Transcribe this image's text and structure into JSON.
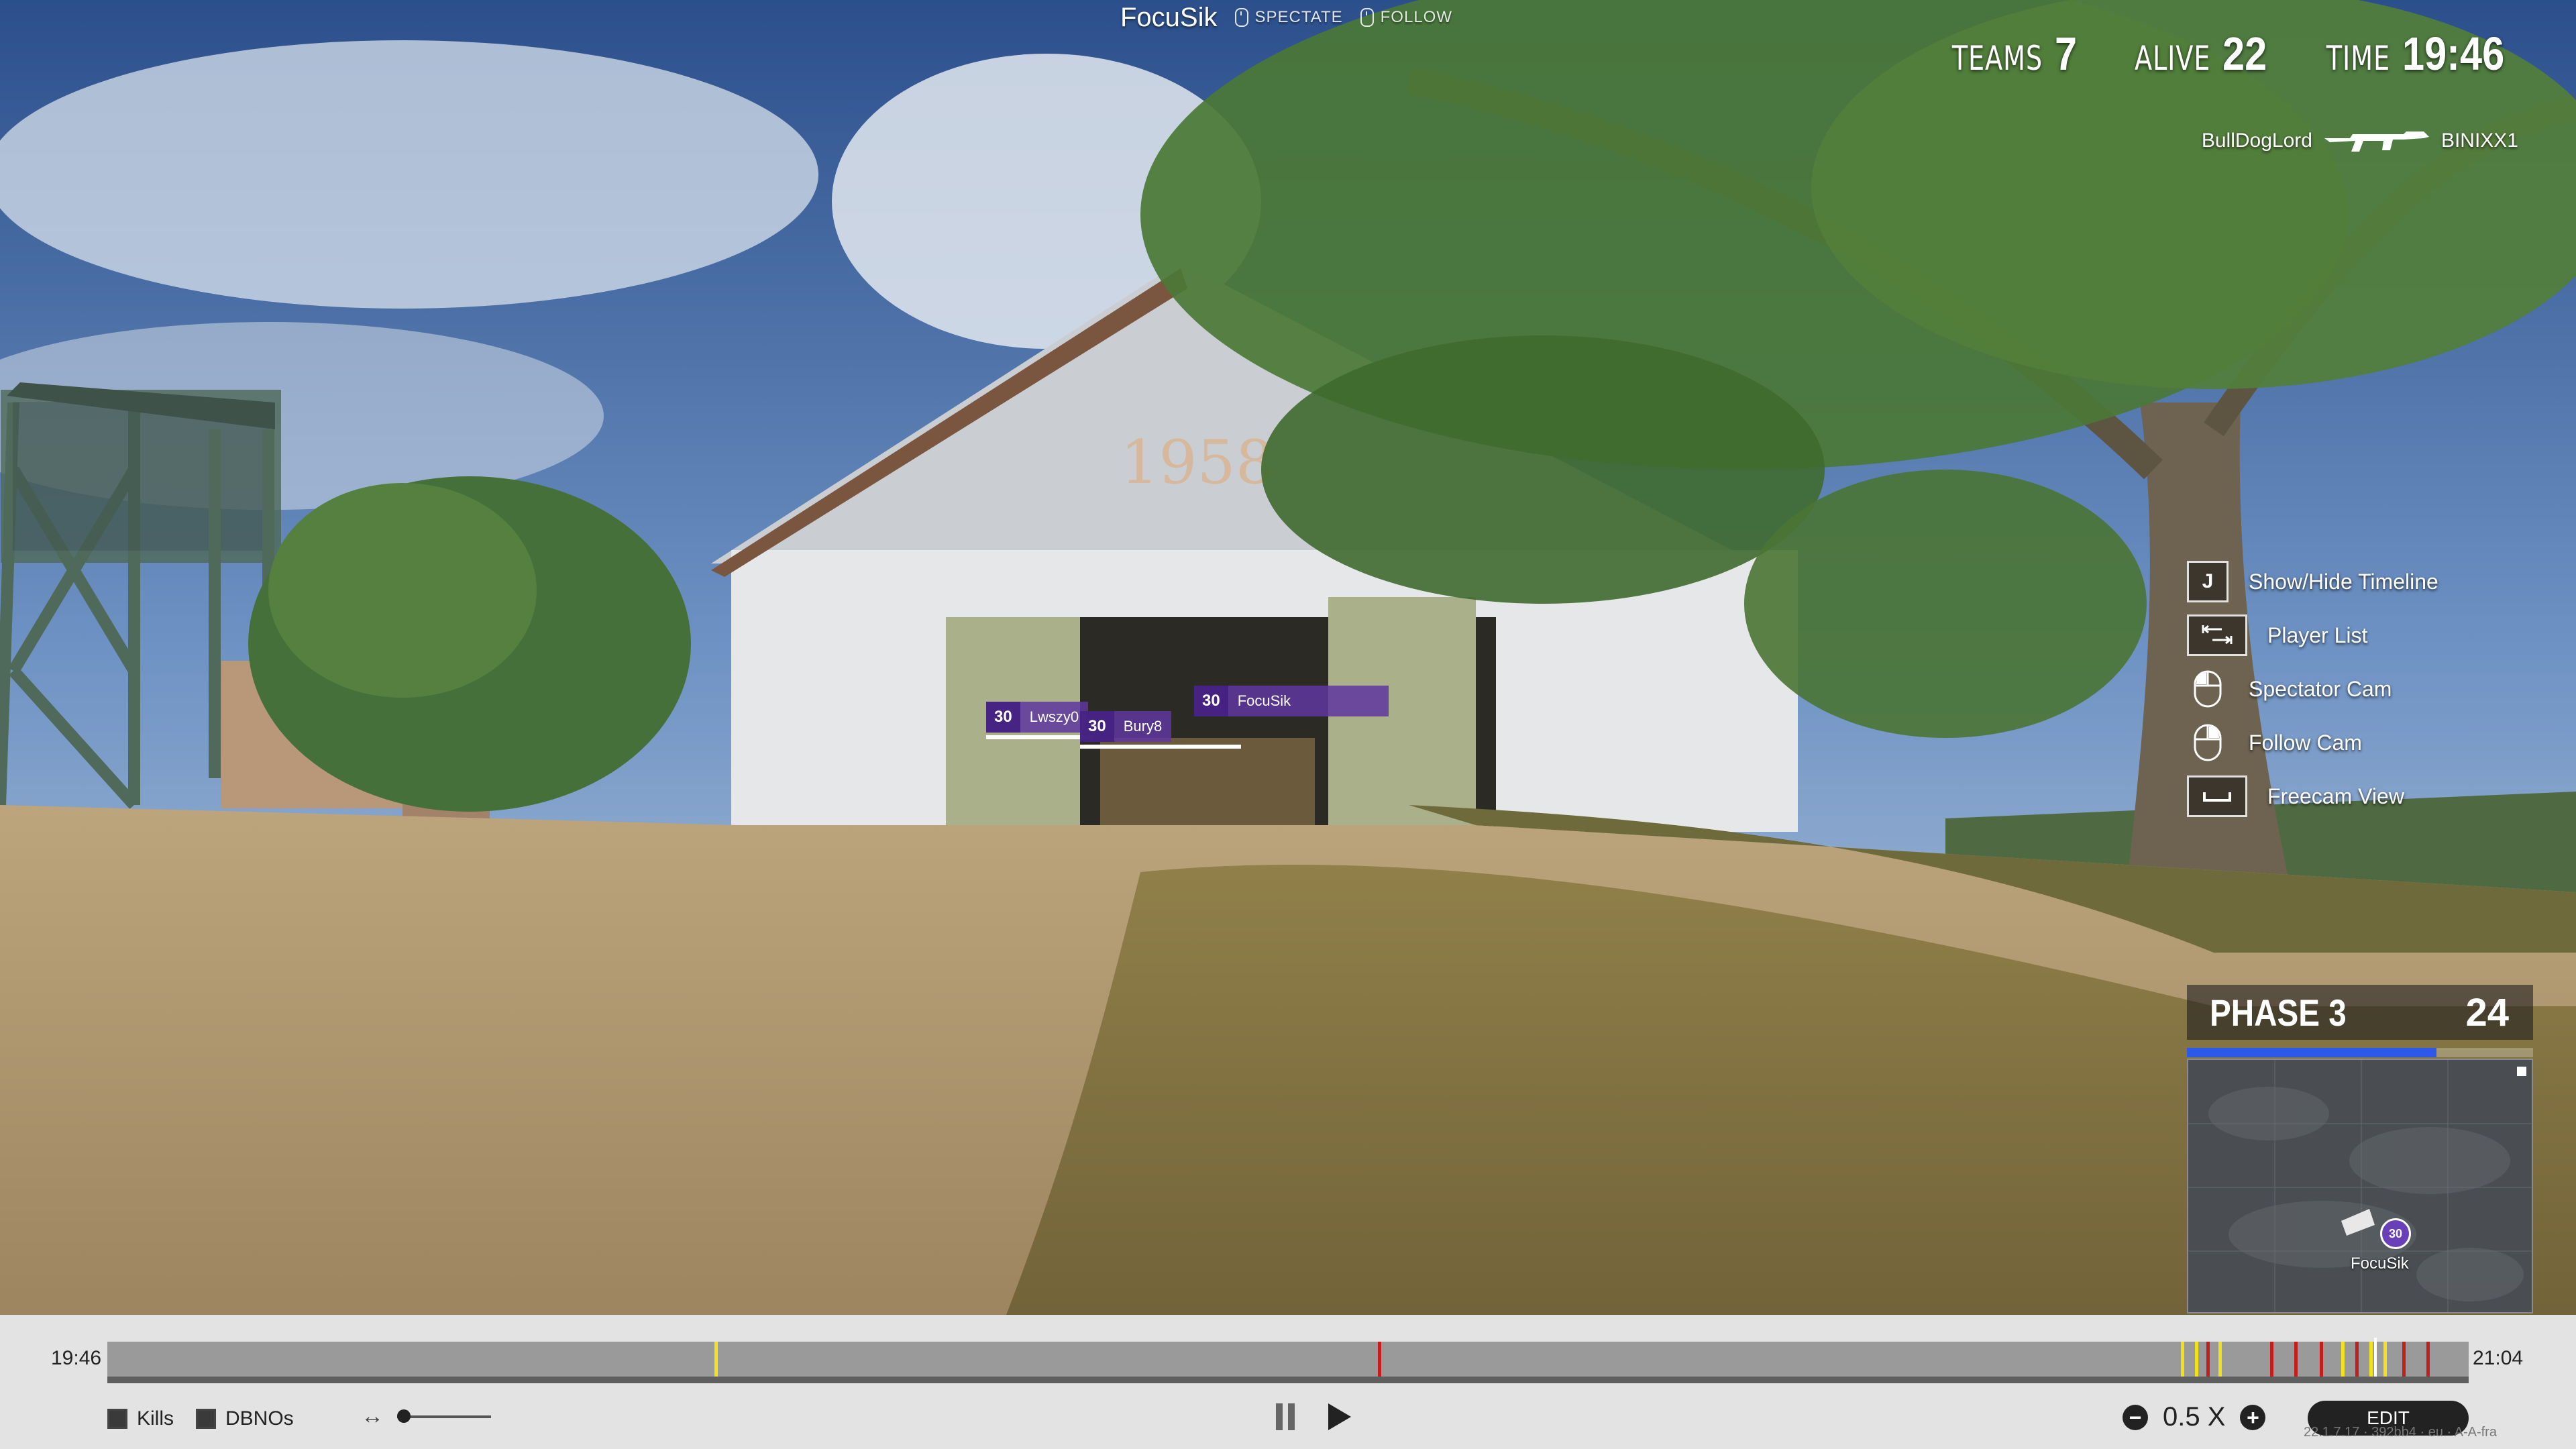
{
  "spectate_bar": {
    "player_name": "FocuSik",
    "spectate_label": "SPECTATE",
    "follow_label": "FOLLOW"
  },
  "stats": {
    "teams_label": "TEAMS",
    "teams_value": "7",
    "alive_label": "ALIVE",
    "alive_value": "22",
    "time_label": "TIME",
    "time_value": "19:46"
  },
  "killfeed": {
    "killer": "BullDogLord",
    "weapon_icon": "assault-rifle-icon",
    "victim": "BINIXX1"
  },
  "hints": [
    {
      "key": "J",
      "label": "Show/Hide Timeline",
      "icon": "key-j"
    },
    {
      "key": "",
      "label": "Player List",
      "icon": "tab-key-icon"
    },
    {
      "key": "",
      "label": "Spectator Cam",
      "icon": "mouse-left-icon"
    },
    {
      "key": "",
      "label": "Follow Cam",
      "icon": "mouse-right-icon"
    },
    {
      "key": "",
      "label": "Freecam View",
      "icon": "space-key-icon"
    }
  ],
  "name_tags": [
    {
      "num": "30",
      "name": "Lwszy0"
    },
    {
      "num": "30",
      "name": "Bury8"
    },
    {
      "num": "30",
      "name": "FocuSik"
    }
  ],
  "phase": {
    "label": "PHASE 3",
    "value": "24",
    "progress": 0.72
  },
  "minimap": {
    "player_label": "FocuSik",
    "marker_num": "30"
  },
  "timeline": {
    "start_time": "19:46",
    "end_time": "21:04",
    "cursor_fraction": 0.96,
    "markers": [
      {
        "pos": 0.257,
        "color": "#f2e21b"
      },
      {
        "pos": 0.538,
        "color": "#c51d1d"
      },
      {
        "pos": 0.878,
        "color": "#f2e21b"
      },
      {
        "pos": 0.884,
        "color": "#f2e21b"
      },
      {
        "pos": 0.889,
        "color": "#c51d1d"
      },
      {
        "pos": 0.894,
        "color": "#f2e21b"
      },
      {
        "pos": 0.916,
        "color": "#c51d1d"
      },
      {
        "pos": 0.926,
        "color": "#c51d1d"
      },
      {
        "pos": 0.937,
        "color": "#c51d1d"
      },
      {
        "pos": 0.946,
        "color": "#f2e21b"
      },
      {
        "pos": 0.952,
        "color": "#c51d1d"
      },
      {
        "pos": 0.958,
        "color": "#f2e21b"
      },
      {
        "pos": 0.964,
        "color": "#f2e21b"
      },
      {
        "pos": 0.972,
        "color": "#c51d1d"
      },
      {
        "pos": 0.982,
        "color": "#c51d1d"
      }
    ],
    "kills_label": "Kills",
    "dbnos_label": "DBNOs",
    "speed_value": "0.5 X",
    "edit_label": "EDIT",
    "version": "22.1.7.17 · 392bb4 · eu · A-A-fra"
  },
  "colors": {
    "tag_purple": "#5f37a0",
    "phase_bar_blue": "#2d58e8",
    "timeline_bg": "#e3e3e3"
  }
}
